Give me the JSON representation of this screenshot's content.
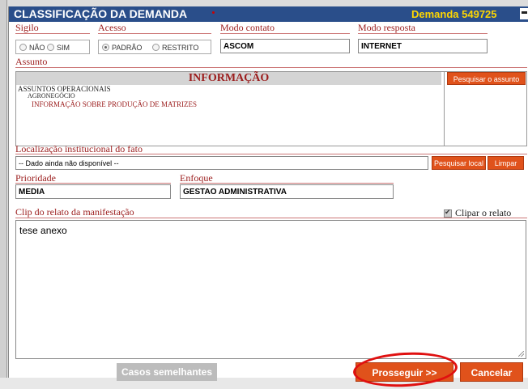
{
  "dialog": {
    "title": "CLASSIFICAÇÃO DA DEMANDA",
    "demanda": "Demanda 549725"
  },
  "sigilo": {
    "label": "Sigilo",
    "options": [
      "NÃO",
      "SIM"
    ]
  },
  "acesso": {
    "label": "Acesso",
    "options": [
      "PADRÃO",
      "RESTRITO"
    ],
    "selected": "PADRÃO"
  },
  "modo_contato": {
    "label": "Modo contato",
    "value": "ASCOM"
  },
  "modo_resposta": {
    "label": "Modo resposta",
    "value": "INTERNET"
  },
  "assunto": {
    "label": "Assunto",
    "heading": "INFORMAÇÃO",
    "tree": [
      "ASSUNTOS OPERACIONAIS",
      "AGRONEGÓCIO",
      "INFORMAÇÃO SOBRE PRODUÇÃO DE MATRIZES"
    ],
    "search_button": "Pesquisar o assunto"
  },
  "localizacao": {
    "label": "Localização institucional do fato",
    "value": "-- Dado ainda não disponível --",
    "search_button": "Pesquisar local",
    "clear_button": "Limpar"
  },
  "prioridade": {
    "label": "Prioridade",
    "value": "MEDIA"
  },
  "enfoque": {
    "label": "Enfoque",
    "value": "GESTAO ADMINISTRATIVA"
  },
  "clip": {
    "label": "Clip do relato da manifestação",
    "checkbox_label": "Clipar o relato",
    "checked": true,
    "text": "tese anexo"
  },
  "buttons": {
    "similar": "Casos semelhantes",
    "proceed": "Prosseguir >>",
    "cancel": "Cancelar"
  },
  "colors": {
    "titlebar": "#2a4e8a",
    "label": "#9b1c1c",
    "action": "#e0521b",
    "demanda": "#ffd700",
    "highlight": "#e01010"
  }
}
